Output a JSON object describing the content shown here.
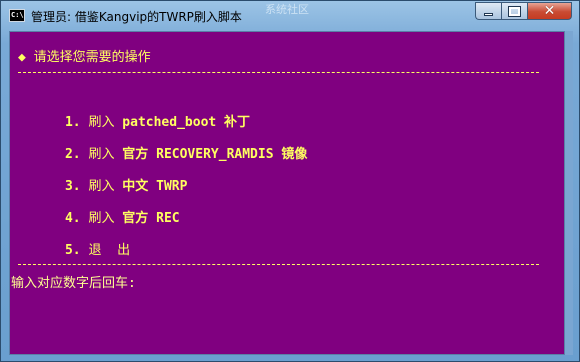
{
  "window": {
    "title": "管理员:  借鉴Kangvip的TWRP刷入脚本",
    "watermark": "系统社区",
    "icon_label": "C:\\",
    "buttons": {
      "minimize": "minimize-icon",
      "maximize": "maximize-icon",
      "close": "close-icon"
    }
  },
  "console": {
    "header": "◆ 请选择您需要的操作",
    "items": [
      {
        "num": "1.",
        "action": "刷入",
        "target": "patched_boot 补丁"
      },
      {
        "num": "2.",
        "action": "刷入",
        "target": "官方 RECOVERY_RAMDIS 镜像"
      },
      {
        "num": "3.",
        "action": "刷入",
        "target": "中文 TWRP"
      },
      {
        "num": "4.",
        "action": "刷入",
        "target": "官方 REC"
      },
      {
        "num": "5.",
        "action": "退  出",
        "target": ""
      }
    ],
    "prompt": "输入对应数字后回车:"
  },
  "colors": {
    "console_bg": "#800080",
    "console_text": "#ffff60"
  }
}
